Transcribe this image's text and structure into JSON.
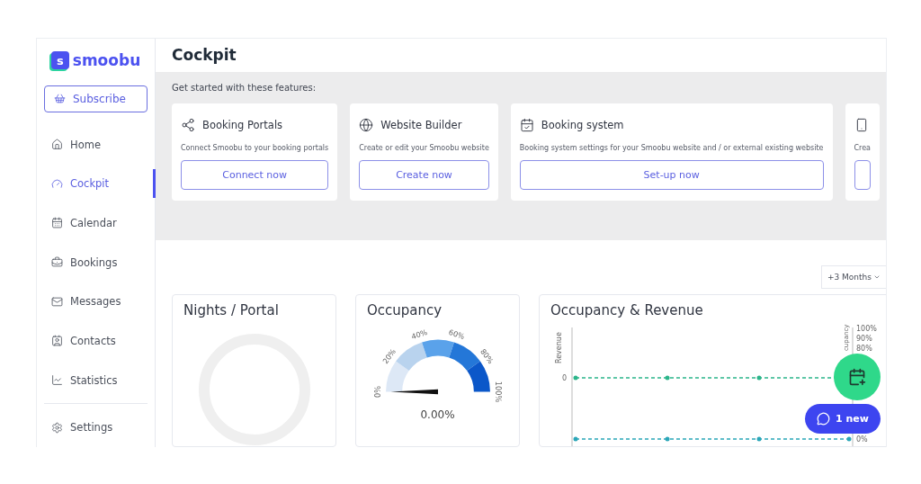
{
  "brand": {
    "name": "smoobu",
    "logo_letter": "s"
  },
  "subscribe": {
    "label": "Subscribe"
  },
  "nav": [
    {
      "label": "Home",
      "selected": false
    },
    {
      "label": "Cockpit",
      "selected": true
    },
    {
      "label": "Calendar",
      "selected": false
    },
    {
      "label": "Bookings",
      "selected": false
    },
    {
      "label": "Messages",
      "selected": false
    },
    {
      "label": "Contacts",
      "selected": false
    },
    {
      "label": "Statistics",
      "selected": false
    }
  ],
  "nav_footer": [
    {
      "label": "Settings",
      "selected": false
    }
  ],
  "page_title": "Cockpit",
  "features": {
    "heading": "Get started with these features:",
    "items": [
      {
        "title": "Booking Portals",
        "description": "Connect Smoobu to your booking portals",
        "button": "Connect now"
      },
      {
        "title": "Website Builder",
        "description": "Create or edit your Smoobu website",
        "button": "Create now"
      },
      {
        "title": "Booking system",
        "description": "Booking system settings for your Smoobu website and / or external existing website",
        "button": "Set-up now"
      },
      {
        "description": "Crea"
      }
    ]
  },
  "period_select": {
    "value": "+3 Months"
  },
  "cards": [
    {
      "kind": "donut",
      "title": "Nights / Portal"
    },
    {
      "kind": "gauge",
      "title": "Occupancy",
      "ticks": [
        "0%",
        "20%",
        "40%",
        "60%",
        "80%",
        "100%"
      ],
      "reading": "0.00%"
    },
    {
      "kind": "combo",
      "title": "Occupancy & Revenue",
      "left_axis": {
        "label": "Revenue",
        "ticks": [
          "0"
        ]
      },
      "right_axis": {
        "label": "cupancy",
        "ticks": [
          "100%",
          "90%",
          "80%",
          "0%"
        ]
      }
    }
  ],
  "fab": {
    "kind": "add-booking"
  },
  "chat_button": {
    "label": "1 new"
  }
}
